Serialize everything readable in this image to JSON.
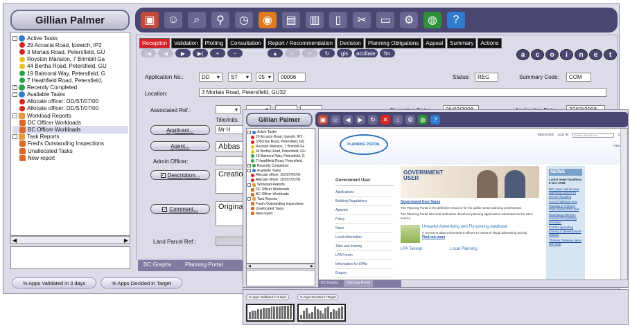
{
  "back": {
    "user": "Gillian Palmer",
    "toolbar_icons": [
      "cube-icon",
      "people-icon",
      "search-magnifier-icon",
      "search-advanced-icon",
      "clock-icon",
      "rss-icon",
      "document-icon",
      "chart-icon",
      "book-icon",
      "tools-icon",
      "window-icon",
      "gear-icon",
      "globe-icon",
      "help-icon"
    ],
    "tree": [
      {
        "level": 0,
        "exp": "-",
        "icon": "active",
        "label": "Active Tasks"
      },
      {
        "level": 1,
        "dot": "red",
        "label": "29 Accacia Road, Ipswich, IP2"
      },
      {
        "level": 1,
        "dot": "red",
        "label": "3 Morlais Road, Petersfield, GU"
      },
      {
        "level": 1,
        "dot": "yel",
        "label": "Royston Mansion, 7 Brimbill Ga"
      },
      {
        "level": 1,
        "dot": "yel",
        "label": "44 Bertha Road, Petersfield, GU"
      },
      {
        "level": 1,
        "dot": "grn",
        "label": "19 Balmoral Way, Petersfield, G"
      },
      {
        "level": 1,
        "dot": "grn",
        "label": "7 Heathfield Road, Petersfield,"
      },
      {
        "level": 0,
        "exp": "+",
        "icon": "chk",
        "label": "Recently Completed"
      },
      {
        "level": 0,
        "exp": "-",
        "icon": "avail",
        "label": "Available Tasks"
      },
      {
        "level": 1,
        "dot": "red",
        "label": "Allocate officer: DD/ST/07/00"
      },
      {
        "level": 1,
        "dot": "red",
        "label": "Allocate officer: DD/ST/07/00"
      },
      {
        "level": 0,
        "exp": "-",
        "icon": "rep",
        "label": "Workload Reports"
      },
      {
        "level": 1,
        "icon": "doc",
        "label": "DC Officer Workloads"
      },
      {
        "level": 1,
        "icon": "doc",
        "label": "BC Officer Workloads"
      },
      {
        "level": 0,
        "exp": "-",
        "icon": "rep",
        "label": "Task Reports"
      },
      {
        "level": 1,
        "icon": "doc",
        "label": "Fred's Outstanding Inspections"
      },
      {
        "level": 1,
        "icon": "doc",
        "label": "Unallocated Tasks"
      },
      {
        "level": 1,
        "icon": "doc",
        "label": "New report"
      }
    ],
    "status_buttons": [
      "% Apps Validated in 3 days",
      "% Apps Decided in Target"
    ],
    "tabs": [
      "Reception",
      "Validation",
      "Plotting",
      "Consultation",
      "Report / Recommendation",
      "Decision",
      "Planning Obligations",
      "Appeal",
      "Summary",
      "Actions"
    ],
    "nav_buttons": [
      "|◀",
      "◀",
      "▶",
      "▶|",
      "+",
      "−"
    ],
    "tool_buttons": [
      "▲",
      "✓",
      "✕",
      "↻",
      "gis",
      "acollate",
      "fm"
    ],
    "acoinet": [
      "a",
      "c",
      "o",
      "i",
      "n",
      "e",
      "t"
    ],
    "form": {
      "application_no_label": "Application No.:",
      "app_dd": "DD",
      "app_st": "ST",
      "app_year": "05",
      "app_num": "00006",
      "status_label": "Status:",
      "status_value": "REG",
      "summary_code_label": "Summary Code:",
      "summary_code_value": "COM",
      "location_label": "Location:",
      "location_value": "3 Morlais Road, Petersfield, GU32",
      "associated_ref_label": "Associated Ref.:",
      "reception_date_label": "Reception Date:",
      "reception_date_value": "06/03/2008",
      "application_date_label": "Application Date:",
      "application_date_value": "22/02/2008",
      "title_inits_label": "Title/Inits.",
      "applicant_btn": "Applicant...",
      "applicant_value": "Mr H",
      "agent_btn": "Agent...",
      "agent_value": "Abbas P",
      "admin_officer_label": "Admin Officer:",
      "description_btn": "Description...",
      "description_value": "Creation",
      "comment_btn": "Comment...",
      "comment_value": "Original",
      "land_parcel_label": "Land Parcel Ref.:"
    },
    "bottom_tabs": [
      "DC Graphs",
      "Planning Portal"
    ]
  },
  "front": {
    "user": "Gillian Palmer",
    "toolbar_icons": [
      "cube-icon",
      "people-icon",
      "back-arrow-icon",
      "forward-arrow-icon",
      "refresh-icon",
      "stop-icon",
      "home-icon",
      "gear-icon",
      "globe-icon",
      "help-icon"
    ],
    "tree": [
      {
        "level": 0,
        "exp": "-",
        "icon": "active",
        "label": "Active Tasks"
      },
      {
        "level": 1,
        "dot": "red",
        "label": "29 Accacia Road, Ipswich, IP2"
      },
      {
        "level": 1,
        "dot": "red",
        "label": "3 Morlais Road, Petersfield, GU"
      },
      {
        "level": 1,
        "dot": "yel",
        "label": "Royston Mansion, 7 Brimbill Ga"
      },
      {
        "level": 1,
        "dot": "yel",
        "label": "44 Bertha Road, Petersfield, GU"
      },
      {
        "level": 1,
        "dot": "grn",
        "label": "19 Balmoral Way, Petersfield, G"
      },
      {
        "level": 1,
        "dot": "grn",
        "label": "7 Heathfield Road, Petersfield,"
      },
      {
        "level": 0,
        "exp": "+",
        "icon": "chk",
        "label": "Recently Completed"
      },
      {
        "level": 0,
        "exp": "-",
        "icon": "avail",
        "label": "Available Tasks"
      },
      {
        "level": 1,
        "dot": "red",
        "label": "Allocate officer: DD/ST/07/00"
      },
      {
        "level": 1,
        "dot": "red",
        "label": "Allocate officer: DD/ST/07/00"
      },
      {
        "level": 0,
        "exp": "-",
        "icon": "rep",
        "label": "Workload Reports"
      },
      {
        "level": 1,
        "icon": "doc",
        "label": "DC Officer Workloads"
      },
      {
        "level": 1,
        "icon": "doc",
        "label": "BC Officer Workloads"
      },
      {
        "level": 0,
        "exp": "-",
        "icon": "rep",
        "label": "Task Reports"
      },
      {
        "level": 1,
        "icon": "doc",
        "label": "Fred's Outstanding Inspections"
      },
      {
        "level": 1,
        "icon": "doc",
        "label": "Unallocated Tasks"
      },
      {
        "level": 1,
        "icon": "doc",
        "label": "New report"
      }
    ],
    "bottom_tabs": [
      "DC Graphs",
      "Planning Portal"
    ],
    "portal": {
      "logo_text": "PLANNING PORTAL",
      "register": "REGISTER",
      "login": "LOG IN",
      "search_placeholder": "Search the site for...",
      "go": "GO",
      "help": "HELP",
      "government_user": "Government User",
      "left_links": [
        "Applications",
        "Building Regulations",
        "Appeals",
        "Policy",
        "News",
        "Local information",
        "Jobs and training",
        "LPA Forum",
        "Information for LPAs",
        "Enquiry"
      ],
      "banner_title_1": "GOVERNMENT",
      "banner_title_2": "USER",
      "crumb": "Government User Home",
      "intro_1": "The Planning Portal is the definitive resource for the public sector planning professional.",
      "intro_2": "The Planning Portal lets local authorities download planning applications submitted via the site's service.",
      "adv_title": "Unlawful Advertising and Fly-posting database",
      "adv_text": "A service to allow enforcement officers to research illegal advertising activity.",
      "find_out_more": "Find out more",
      "lpa_takeup": "LPA Takeup",
      "local_planning": "Local Planning",
      "news_title": "NEWS",
      "news_sub": "Latest news headlines 8 Nov 2008",
      "news_items": [
        "RPs back call for new planning controls to prevent flooding",
        "Local challenge over housing in Thames Town meets RRA fails",
        "Watchdog criticises council over parking provision",
        "Call for appealing training in development studies",
        "Thames Gateway takes one step"
      ]
    }
  },
  "thumbs": {
    "labels": [
      "% Apps Validated in 3 days",
      "% Apps Decided in Target"
    ],
    "bars1": [
      0.5,
      0.6,
      0.6,
      0.7,
      0.7,
      0.8,
      0.8,
      0.8,
      0.9,
      0.9,
      0.9,
      0.9,
      0.95,
      0.95,
      0.95,
      1
    ],
    "bars2": [
      0.3,
      0.6,
      0.8,
      0.4,
      0.5,
      0.9,
      0.7,
      0.6,
      0.4,
      0.8,
      0.9,
      0.5,
      0.7,
      0.6,
      0.8,
      0.9
    ]
  }
}
